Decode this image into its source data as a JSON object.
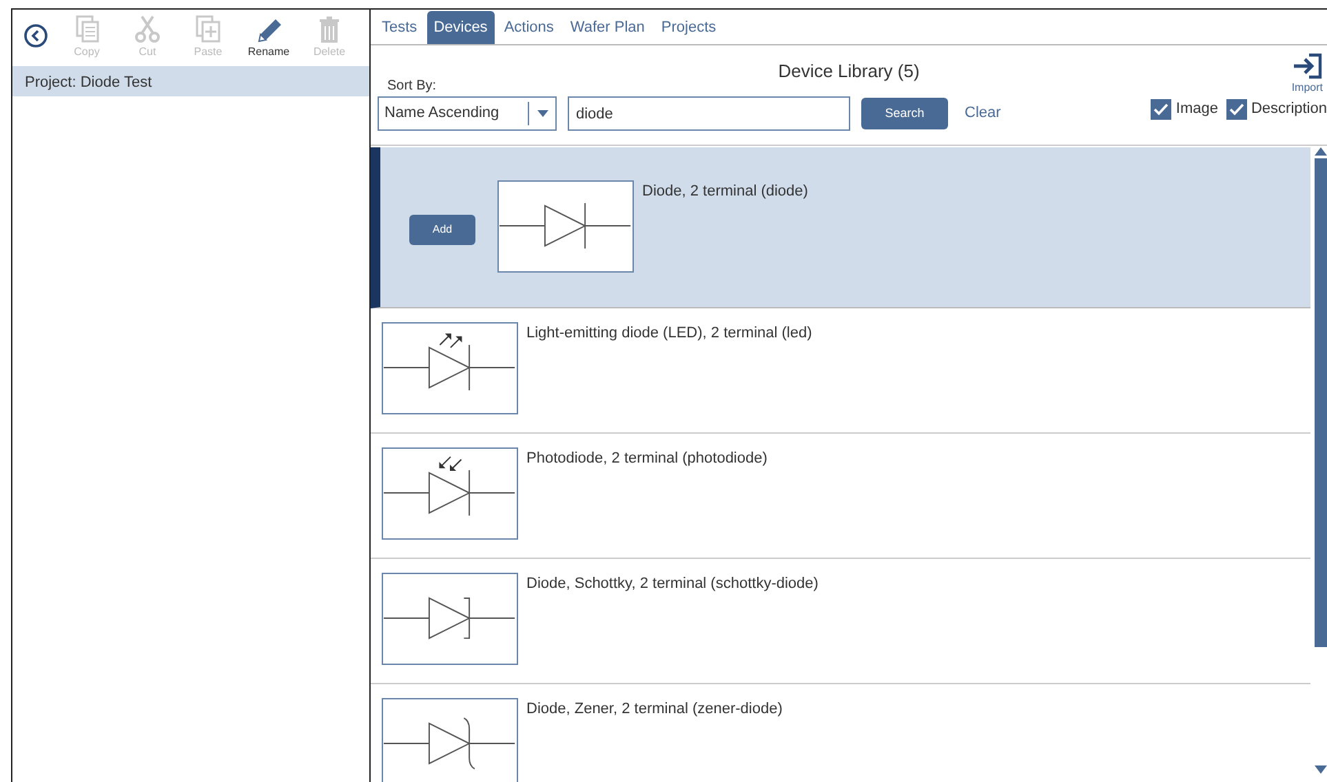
{
  "toolbar": [
    {
      "label": "Copy",
      "kind": "copy",
      "disabled": true
    },
    {
      "label": "Cut",
      "kind": "cut",
      "disabled": true
    },
    {
      "label": "Paste",
      "kind": "paste",
      "disabled": true
    },
    {
      "label": "Rename",
      "kind": "rename",
      "disabled": false
    },
    {
      "label": "Delete",
      "kind": "delete",
      "disabled": true
    }
  ],
  "project": {
    "label": "Project: Diode Test",
    "selected": true
  },
  "tabs": [
    {
      "label": "Tests",
      "selected": false
    },
    {
      "label": "Devices",
      "selected": true
    },
    {
      "label": "Actions",
      "selected": false
    },
    {
      "label": "Wafer Plan",
      "selected": false
    },
    {
      "label": "Projects",
      "selected": false
    }
  ],
  "library": {
    "title": "Device Library (5)",
    "sort_label": "Sort By:",
    "sort_value": "Name Ascending",
    "search_value": "diode",
    "search_button": "Search",
    "clear_link": "Clear",
    "import_label": "Import",
    "options": [
      {
        "label": "Image",
        "checked": true
      },
      {
        "label": "Description",
        "checked": true
      }
    ]
  },
  "devices": [
    {
      "kind": "diode",
      "label": "Diode, 2 terminal (diode)",
      "selected": true,
      "action": "Add"
    },
    {
      "kind": "led",
      "label": "Light-emitting diode (LED), 2 terminal (led)",
      "selected": false
    },
    {
      "kind": "photodiode",
      "label": "Photodiode, 2 terminal (photodiode)",
      "selected": false
    },
    {
      "kind": "schottky",
      "label": "Diode, Schottky, 2 terminal (schottky-diode)",
      "selected": false
    },
    {
      "kind": "zener",
      "label": "Diode, Zener, 2 terminal (zener-diode)",
      "selected": false
    }
  ]
}
